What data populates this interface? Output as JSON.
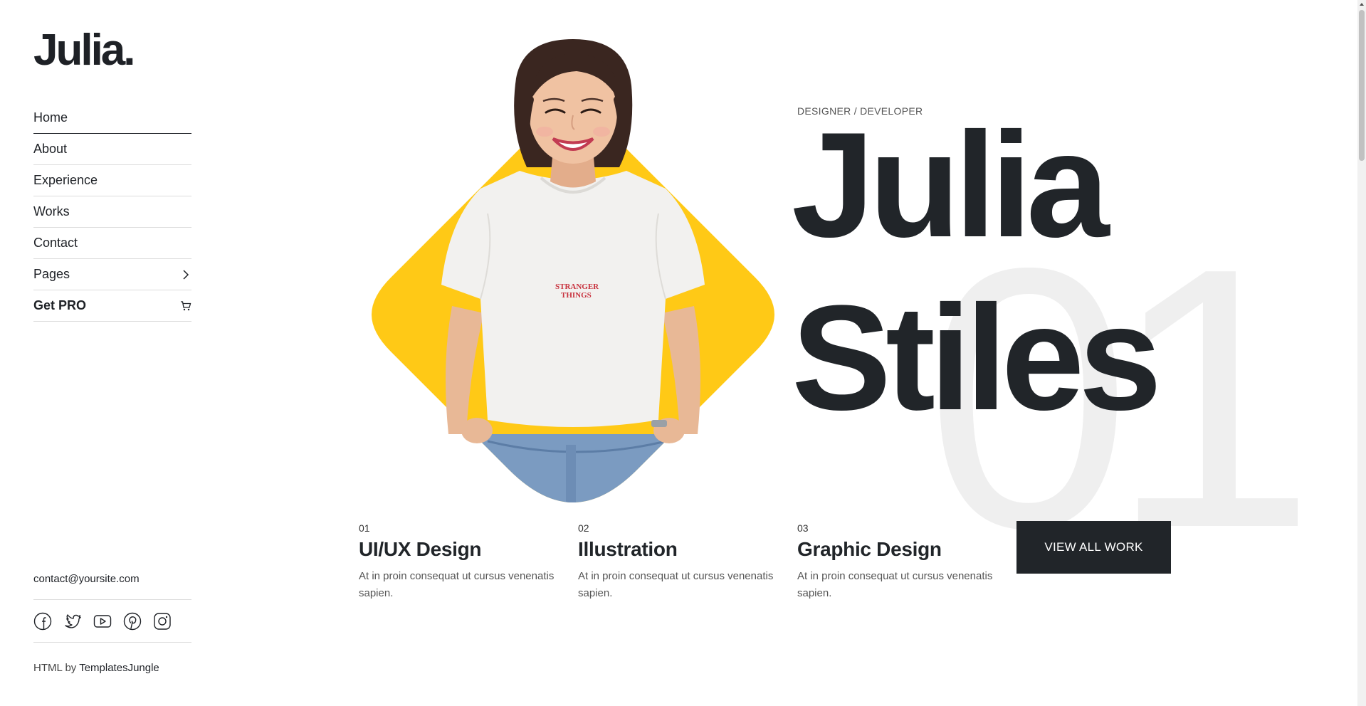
{
  "sidebar": {
    "logo": "Julia.",
    "nav": [
      {
        "label": "Home"
      },
      {
        "label": "About"
      },
      {
        "label": "Experience"
      },
      {
        "label": "Works"
      },
      {
        "label": "Contact"
      },
      {
        "label": "Pages",
        "icon": "chevron-right-icon"
      },
      {
        "label": "Get PRO",
        "icon": "cart-icon"
      }
    ],
    "contact_email": "contact@yoursite.com",
    "socials": [
      "facebook-icon",
      "twitter-icon",
      "youtube-icon",
      "pinterest-icon",
      "instagram-icon"
    ],
    "credit_prefix": "HTML by",
    "credit_link": "TemplatesJungle"
  },
  "hero": {
    "tagline": "DESIGNER / DEVELOPER",
    "first_name": "Julia",
    "last_name": "Stiles",
    "background_number": "01",
    "shirt_text_1": "STRANGER",
    "shirt_text_2": "THINGS",
    "accent_color": "#ffc916"
  },
  "services": [
    {
      "num": "01",
      "title": "UI/UX Design",
      "desc": "At in proin consequat ut cursus venenatis sapien."
    },
    {
      "num": "02",
      "title": "Illustration",
      "desc": "At in proin consequat ut cursus venenatis sapien."
    },
    {
      "num": "03",
      "title": "Graphic Design",
      "desc": "At in proin consequat ut cursus venenatis sapien."
    }
  ],
  "cta": {
    "label": "VIEW ALL WORK"
  }
}
